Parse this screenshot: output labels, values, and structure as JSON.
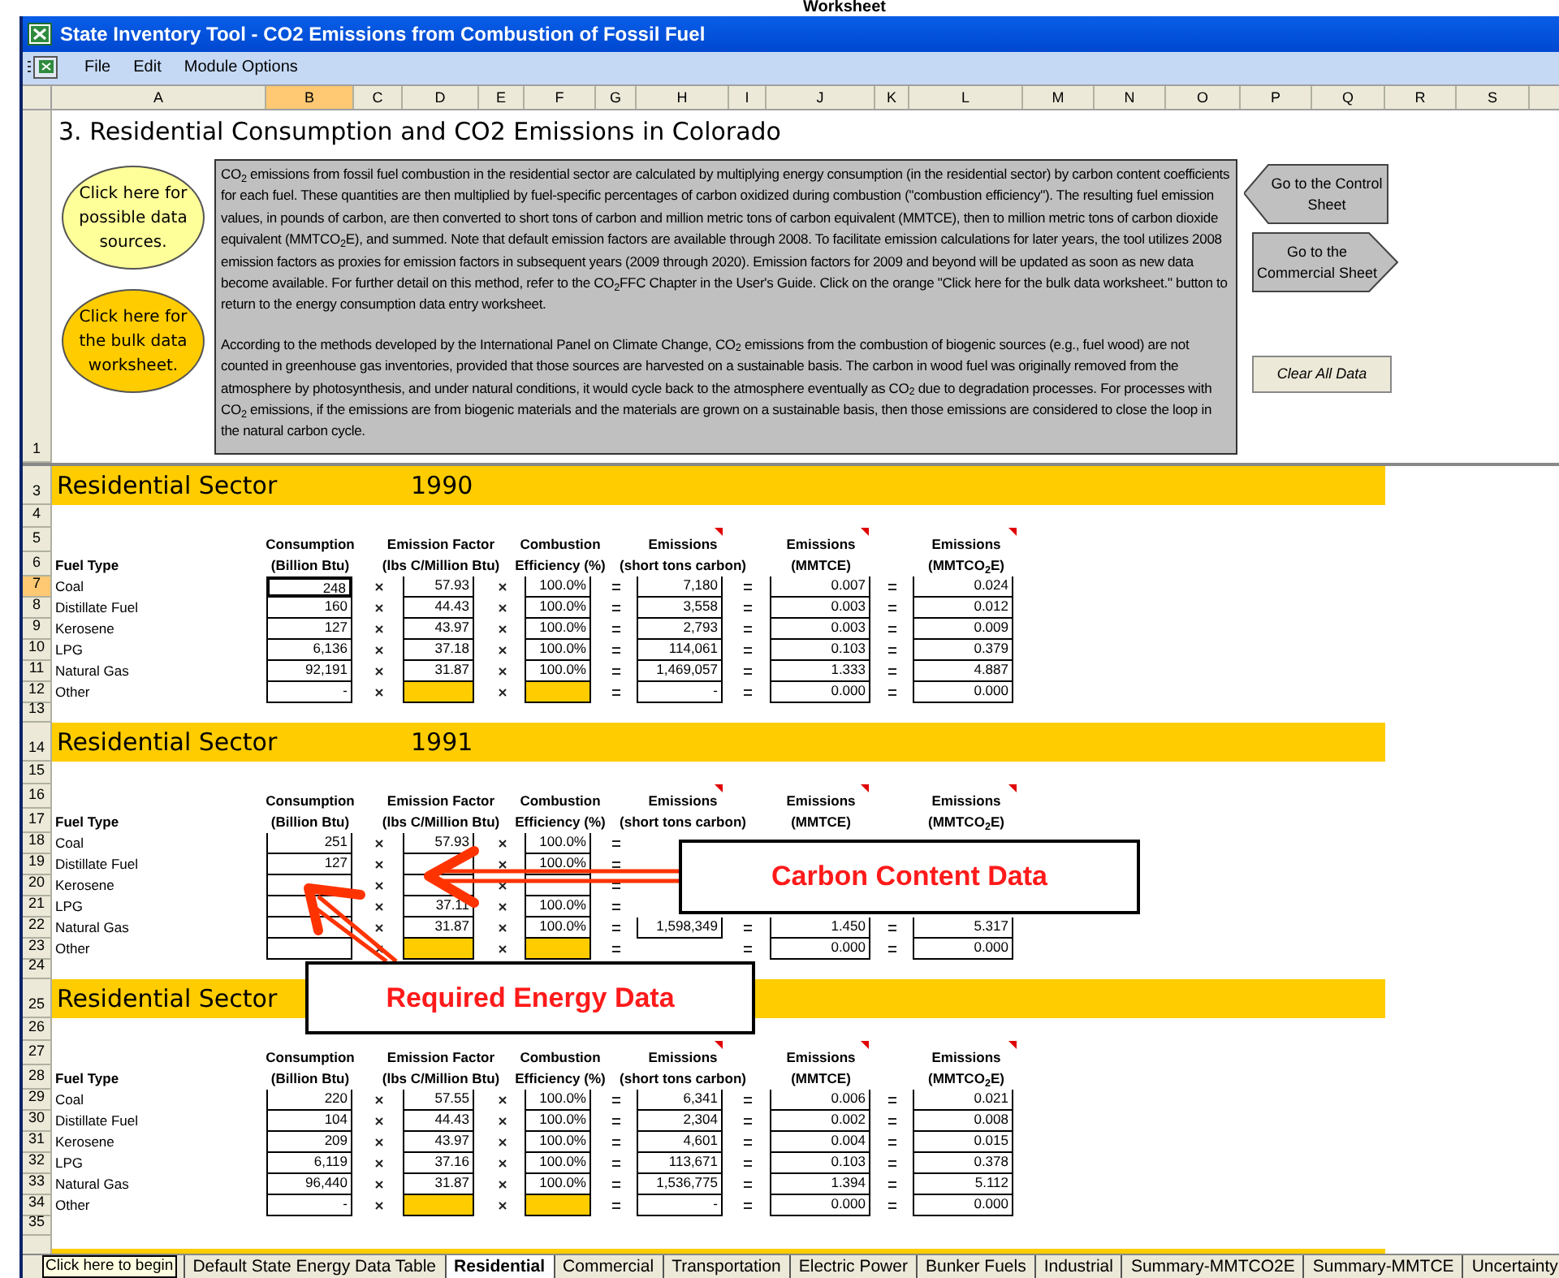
{
  "top_heading": "Worksheet",
  "window": {
    "title": "State Inventory Tool - CO2 Emissions from Combustion of Fossil Fuel"
  },
  "menu": [
    "File",
    "Edit",
    "Module Options"
  ],
  "columns": [
    {
      "label": "A",
      "selected": false
    },
    {
      "label": "B",
      "selected": true
    },
    {
      "label": "C",
      "selected": false
    },
    {
      "label": "D",
      "selected": false
    },
    {
      "label": "E",
      "selected": false
    },
    {
      "label": "F",
      "selected": false
    },
    {
      "label": "G",
      "selected": false
    },
    {
      "label": "H",
      "selected": false
    },
    {
      "label": "I",
      "selected": false
    },
    {
      "label": "J",
      "selected": false
    },
    {
      "label": "K",
      "selected": false
    },
    {
      "label": "L",
      "selected": false
    },
    {
      "label": "M",
      "selected": false
    },
    {
      "label": "N",
      "selected": false
    },
    {
      "label": "O",
      "selected": false
    },
    {
      "label": "P",
      "selected": false
    },
    {
      "label": "Q",
      "selected": false
    },
    {
      "label": "R",
      "selected": false
    },
    {
      "label": "S",
      "selected": false
    }
  ],
  "intro": {
    "row": "1",
    "title": "3. Residential Consumption and CO2 Emissions in Colorado",
    "bubbles": [
      {
        "kind": "sources",
        "label": "Click here for possible data sources."
      },
      {
        "kind": "bulk",
        "label": "Click here for the bulk data worksheet."
      }
    ],
    "description": [
      "CO$_{2}$ emissions from fossil fuel combustion in the residential sector are calculated by multiplying energy consumption (in the residential sector) by carbon content coefficients for each fuel.  These quantities are then multiplied by fuel-specific percentages of carbon oxidized during combustion (\"combustion efficiency\").  The resulting fuel emission values, in pounds of carbon, are then converted to short tons of carbon and million metric tons of carbon equivalent (MMTCE), then to million metric tons of carbon dioxide equivalent (MMTCO$_{2}$E), and summed.  Note that default emission factors are available through 2008.  To facilitate emission calculations for later years, the tool utilizes 2008 emission factors as proxies for emission factors in subsequent years (2009 through 2020).  Emission factors for 2009 and beyond will be updated as soon as new data become available.  For further detail on this method, refer to the CO$_{2}$FFC Chapter in the User's Guide. Click on the orange \"Click here for the bulk data worksheet.\" button to return to the energy consumption data entry worksheet.",
      "According to the methods developed by the International Panel on Climate Change, CO$_{2}$ emissions from the combustion of biogenic sources (e.g., fuel wood) are not counted in greenhouse gas inventories, provided that those sources are harvested on a sustainable basis. The carbon in wood fuel was originally removed from the atmosphere by photosynthesis, and under natural conditions, it would cycle back to the atmosphere eventually as CO$_{2}$ due to degradation processes. For processes with CO$_{2}$ emissions, if the emissions are from biogenic materials and the materials are grown on a sustainable basis, then those emissions are considered to close the loop in the natural carbon cycle."
    ],
    "nav_buttons": [
      {
        "kind": "back",
        "label": "Go to the Control Sheet"
      },
      {
        "kind": "forward",
        "label": "Go to the Commercial Sheet"
      }
    ],
    "clear_button": "Clear All Data"
  },
  "sections": [
    {
      "band_row": "3",
      "title": "Residential Sector",
      "year": "1990",
      "blank_row": "4",
      "header_rows": [
        "5",
        "6"
      ],
      "fuel_header": "Fuel Type",
      "column_headers": [
        "Consumption\n(Billion Btu)",
        "Emission Factor\n(lbs C/Million Btu)",
        "Combustion\nEfficiency (%)",
        "Emissions\n(short tons carbon)",
        "Emissions\n(MMTCE)",
        "Emissions\n(MMTCO$_{2}$E)"
      ],
      "end_row": "13",
      "rows": [
        {
          "row": "7",
          "selected": true,
          "fuel": "Coal",
          "consumption": "248",
          "factor": "57.93",
          "efficiency": "100.0%",
          "short_tons": "7,180",
          "mmtce": "0.007",
          "mmtco2e": "0.024"
        },
        {
          "row": "8",
          "selected": false,
          "fuel": "Distillate Fuel",
          "consumption": "160",
          "factor": "44.43",
          "efficiency": "100.0%",
          "short_tons": "3,558",
          "mmtce": "0.003",
          "mmtco2e": "0.012"
        },
        {
          "row": "9",
          "selected": false,
          "fuel": "Kerosene",
          "consumption": "127",
          "factor": "43.97",
          "efficiency": "100.0%",
          "short_tons": "2,793",
          "mmtce": "0.003",
          "mmtco2e": "0.009"
        },
        {
          "row": "10",
          "selected": false,
          "fuel": "LPG",
          "consumption": "6,136",
          "factor": "37.18",
          "efficiency": "100.0%",
          "short_tons": "114,061",
          "mmtce": "0.103",
          "mmtco2e": "0.379"
        },
        {
          "row": "11",
          "selected": false,
          "fuel": "Natural Gas",
          "consumption": "92,191",
          "factor": "31.87",
          "efficiency": "100.0%",
          "short_tons": "1,469,057",
          "mmtce": "1.333",
          "mmtco2e": "4.887"
        },
        {
          "row": "12",
          "selected": false,
          "fuel": "Other",
          "consumption": "-",
          "inputs_missing": true,
          "short_tons": "-",
          "mmtce": "0.000",
          "mmtco2e": "0.000"
        }
      ]
    },
    {
      "band_row": "14",
      "title": "Residential Sector",
      "year": "1991",
      "blank_row": "15",
      "header_rows": [
        "16",
        "17"
      ],
      "fuel_header": "Fuel Type",
      "column_headers": [
        "Consumption\n(Billion Btu)",
        "Emission Factor\n(lbs C/Million Btu)",
        "Combustion\nEfficiency (%)",
        "Emissions\n(short tons carbon)",
        "Emissions\n(MMTCE)",
        "Emissions\n(MMTCO$_{2}$E)"
      ],
      "end_row": "24",
      "rows": [
        {
          "row": "18",
          "selected": false,
          "fuel": "Coal",
          "consumption": "251",
          "factor": "57.93",
          "efficiency": "100.0%"
        },
        {
          "row": "19",
          "selected": false,
          "fuel": "Distillate Fuel",
          "consumption": "127",
          "efficiency": "100.0%"
        },
        {
          "row": "20",
          "selected": false,
          "fuel": "Kerosene"
        },
        {
          "row": "21",
          "selected": false,
          "fuel": "LPG",
          "factor": "37.11",
          "efficiency": "100.0%"
        },
        {
          "row": "22",
          "selected": false,
          "fuel": "Natural Gas",
          "factor": "31.87",
          "efficiency": "100.0%",
          "short_tons": "1,598,349",
          "mmtce": "1.450",
          "mmtco2e": "5.317"
        },
        {
          "row": "23",
          "selected": false,
          "fuel": "Other",
          "inputs_missing": true,
          "mmtce": "0.000",
          "mmtco2e": "0.000"
        }
      ]
    },
    {
      "band_row": "25",
      "title": "Residential Sector",
      "blank_row": "26",
      "header_rows": [
        "27",
        "28"
      ],
      "fuel_header": "Fuel Type",
      "column_headers": [
        "Consumption\n(Billion Btu)",
        "Emission Factor\n(lbs C/Million Btu)",
        "Combustion\nEfficiency (%)",
        "Emissions\n(short tons carbon)",
        "Emissions\n(MMTCE)",
        "Emissions\n(MMTCO$_{2}$E)"
      ],
      "end_row": "35",
      "rows": [
        {
          "row": "29",
          "selected": false,
          "fuel": "Coal",
          "consumption": "220",
          "factor": "57.55",
          "efficiency": "100.0%",
          "short_tons": "6,341",
          "mmtce": "0.006",
          "mmtco2e": "0.021"
        },
        {
          "row": "30",
          "selected": false,
          "fuel": "Distillate Fuel",
          "consumption": "104",
          "factor": "44.43",
          "efficiency": "100.0%",
          "short_tons": "2,304",
          "mmtce": "0.002",
          "mmtco2e": "0.008"
        },
        {
          "row": "31",
          "selected": false,
          "fuel": "Kerosene",
          "consumption": "209",
          "factor": "43.97",
          "efficiency": "100.0%",
          "short_tons": "4,601",
          "mmtce": "0.004",
          "mmtco2e": "0.015"
        },
        {
          "row": "32",
          "selected": false,
          "fuel": "LPG",
          "consumption": "6,119",
          "factor": "37.16",
          "efficiency": "100.0%",
          "short_tons": "113,671",
          "mmtce": "0.103",
          "mmtco2e": "0.378"
        },
        {
          "row": "33",
          "selected": false,
          "fuel": "Natural Gas",
          "consumption": "96,440",
          "factor": "31.87",
          "efficiency": "100.0%",
          "short_tons": "1,536,775",
          "mmtce": "1.394",
          "mmtco2e": "5.112"
        },
        {
          "row": "34",
          "selected": false,
          "fuel": "Other",
          "consumption": "-",
          "inputs_missing": true,
          "short_tons": "-",
          "mmtce": "0.000",
          "mmtco2e": "0.000"
        }
      ]
    }
  ],
  "callouts": [
    {
      "kind": "carbon",
      "label": "Carbon Content Data"
    },
    {
      "kind": "energy",
      "label": "Required Energy Data"
    }
  ],
  "tooltip": "Click here to begin",
  "sheet_tabs": [
    {
      "label": "Default State Energy Data Table",
      "selected": false
    },
    {
      "label": "Residential",
      "selected": true
    },
    {
      "label": "Commercial",
      "selected": false
    },
    {
      "label": "Transportation",
      "selected": false
    },
    {
      "label": "Electric Power",
      "selected": false
    },
    {
      "label": "Bunker Fuels",
      "selected": false
    },
    {
      "label": "Industrial",
      "selected": false
    },
    {
      "label": "Summary-MMTCO2E",
      "selected": false
    },
    {
      "label": "Summary-MMTCE",
      "selected": false
    },
    {
      "label": "Uncertainty",
      "selected": false
    }
  ]
}
